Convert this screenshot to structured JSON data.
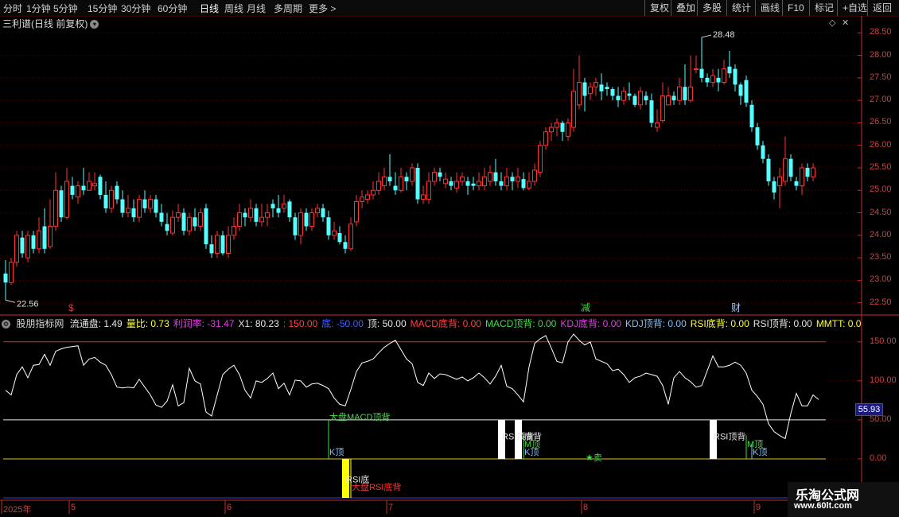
{
  "toolbar": {
    "timeframes": [
      "分时",
      "1分钟",
      "5分钟",
      "15分钟",
      "30分钟",
      "60分钟",
      "日线",
      "周线",
      "月线",
      "多周期",
      "更多 >"
    ],
    "active": "日线",
    "right_buttons": [
      "复权",
      "叠加",
      "多股",
      "统计",
      "画线",
      "F10",
      "标记",
      "+自选",
      "返回"
    ]
  },
  "main": {
    "title": "三利谱(日线 前复权)",
    "high_label": "28.48",
    "low_label": "22.56",
    "markers": [
      {
        "text": "$",
        "color": "#ff3030",
        "index": 12
      },
      {
        "text": "减",
        "color": "#30e030",
        "index": 104
      },
      {
        "text": "财",
        "color": "#9ec8ff",
        "index": 131
      }
    ]
  },
  "indicator": {
    "title": "股朋指标网",
    "fields": [
      {
        "text": "流通盘: 1.49",
        "color": "#e6e6e6"
      },
      {
        "text": "量比: 0.73",
        "color": "#ffff40"
      },
      {
        "text": "利润率: -31.47",
        "color": "#e040e0"
      },
      {
        "text": "X1: 80.23",
        "color": "#e6e6e6"
      },
      {
        "text": ": 150.00",
        "color": "#ff4040"
      },
      {
        "text": "底: -50.00",
        "color": "#4060ff"
      },
      {
        "text": "顶: 50.00",
        "color": "#e6e6e6"
      },
      {
        "text": "MACD底背: 0.00",
        "color": "#ff4040"
      },
      {
        "text": "MACD顶背: 0.00",
        "color": "#40e040"
      },
      {
        "text": "KDJ底背: 0.00",
        "color": "#e040e0"
      },
      {
        "text": "KDJ顶背: 0.00",
        "color": "#80c0ff"
      },
      {
        "text": "RSI底背: 0.00",
        "color": "#ffff40"
      },
      {
        "text": "RSI顶背: 0.00",
        "color": "#e6e6e6"
      },
      {
        "text": "MMTT: 0.0",
        "color": "#ffff40"
      }
    ],
    "current_value": "55.93",
    "annotations": [
      {
        "text": "大盘MACD顶背",
        "color": "#40e040",
        "index": 58,
        "y": 50
      },
      {
        "text": "K顶",
        "color": "#80c0ff",
        "index": 58,
        "y": 5
      },
      {
        "text": "RSI底",
        "color": "#e6e6e6",
        "index": 61,
        "y": -30
      },
      {
        "text": "大盘RSI底背",
        "color": "#ff3030",
        "index": 62,
        "y": -40
      },
      {
        "text": "RSI顶背",
        "color": "#e6e6e6",
        "index": 89,
        "y": 25
      },
      {
        "text": "底背",
        "color": "#e6e6e6",
        "index": 93,
        "y": 25
      },
      {
        "text": "M顶",
        "color": "#40e040",
        "index": 93,
        "y": 15
      },
      {
        "text": "K顶",
        "color": "#80c0ff",
        "index": 93,
        "y": 5
      },
      {
        "text": "★卖",
        "color": "#40e040",
        "index": 104,
        "y": -2
      },
      {
        "text": "RSI顶背",
        "color": "#e6e6e6",
        "index": 127,
        "y": 25
      },
      {
        "text": "M顶",
        "color": "#40e040",
        "index": 133,
        "y": 15
      },
      {
        "text": "K顶",
        "color": "#80c0ff",
        "index": 134,
        "y": 5
      }
    ]
  },
  "axes": {
    "price_ticks": [
      "28.50",
      "28.00",
      "27.50",
      "27.00",
      "26.50",
      "26.00",
      "25.50",
      "25.00",
      "24.50",
      "24.00",
      "23.50",
      "23.00",
      "22.50"
    ],
    "indicator_ticks": [
      "150.00",
      "100.00",
      "50.00",
      "0.00"
    ],
    "date_labels": [
      {
        "text": "2025年",
        "index": 0
      },
      {
        "text": "5",
        "index": 12
      },
      {
        "text": "6",
        "index": 40
      },
      {
        "text": "7",
        "index": 69
      },
      {
        "text": "8",
        "index": 104
      },
      {
        "text": "9",
        "index": 135
      }
    ]
  },
  "watermark": {
    "name": "乐淘公式网",
    "url": "www.60lt.com"
  },
  "chart_data": {
    "type": "candlestick",
    "candles": [
      [
        23.15,
        22.95,
        23.45,
        22.56
      ],
      [
        22.95,
        23.4,
        23.5,
        22.9
      ],
      [
        23.4,
        24.0,
        24.1,
        23.3
      ],
      [
        23.95,
        23.6,
        24.1,
        23.5
      ],
      [
        23.5,
        24.0,
        24.1,
        23.4
      ],
      [
        24.0,
        23.7,
        24.1,
        23.6
      ],
      [
        23.7,
        24.1,
        24.4,
        23.6
      ],
      [
        24.2,
        23.7,
        24.6,
        23.6
      ],
      [
        23.75,
        24.2,
        24.8,
        23.7
      ],
      [
        24.2,
        25.0,
        25.4,
        24.1
      ],
      [
        25.0,
        24.4,
        25.1,
        24.3
      ],
      [
        24.4,
        25.2,
        25.5,
        24.35
      ],
      [
        25.1,
        24.9,
        25.3,
        24.8
      ],
      [
        24.85,
        25.1,
        25.2,
        24.7
      ],
      [
        25.1,
        25.0,
        25.5,
        24.9
      ],
      [
        25.0,
        25.2,
        25.4,
        25.0
      ],
      [
        25.1,
        25.15,
        25.4,
        25.0
      ],
      [
        25.3,
        24.9,
        25.35,
        24.8
      ],
      [
        24.9,
        24.6,
        25.2,
        24.5
      ],
      [
        24.6,
        25.0,
        25.1,
        24.5
      ],
      [
        25.1,
        24.8,
        25.2,
        24.7
      ],
      [
        24.8,
        24.5,
        25.0,
        24.4
      ],
      [
        24.5,
        24.6,
        24.9,
        24.4
      ],
      [
        24.6,
        24.4,
        24.8,
        24.3
      ],
      [
        24.4,
        24.8,
        24.9,
        24.3
      ],
      [
        24.8,
        24.6,
        25.0,
        24.5
      ],
      [
        24.6,
        24.8,
        24.9,
        24.5
      ],
      [
        24.8,
        24.5,
        24.9,
        24.4
      ],
      [
        24.5,
        24.3,
        24.7,
        24.2
      ],
      [
        24.25,
        24.1,
        24.5,
        24.0
      ],
      [
        24.05,
        24.4,
        24.55,
        24.0
      ],
      [
        24.4,
        24.5,
        24.7,
        24.3
      ],
      [
        24.5,
        24.1,
        24.6,
        24.0
      ],
      [
        24.1,
        24.4,
        24.5,
        24.0
      ],
      [
        24.4,
        24.2,
        24.6,
        24.1
      ],
      [
        24.2,
        24.5,
        24.6,
        24.1
      ],
      [
        24.6,
        23.8,
        24.7,
        23.7
      ],
      [
        23.8,
        23.6,
        24.0,
        23.5
      ],
      [
        23.6,
        24.0,
        24.1,
        23.5
      ],
      [
        24.0,
        23.6,
        24.1,
        23.55
      ],
      [
        23.6,
        24.0,
        24.2,
        23.5
      ],
      [
        24.0,
        24.2,
        24.4,
        23.9
      ],
      [
        24.2,
        24.5,
        24.7,
        24.1
      ],
      [
        24.5,
        24.4,
        24.6,
        24.2
      ],
      [
        24.4,
        24.6,
        24.8,
        24.3
      ],
      [
        24.6,
        24.3,
        24.7,
        24.2
      ],
      [
        24.3,
        24.4,
        24.7,
        24.2
      ],
      [
        24.4,
        24.5,
        24.7,
        24.2
      ],
      [
        24.7,
        24.6,
        24.8,
        24.4
      ],
      [
        24.6,
        24.5,
        24.9,
        24.4
      ],
      [
        24.6,
        24.7,
        24.9,
        24.5
      ],
      [
        24.75,
        24.4,
        24.8,
        24.3
      ],
      [
        24.4,
        24.0,
        24.5,
        23.9
      ],
      [
        24.0,
        24.5,
        24.6,
        23.8
      ],
      [
        24.5,
        24.2,
        24.6,
        24.1
      ],
      [
        24.2,
        24.5,
        24.6,
        24.1
      ],
      [
        24.5,
        24.6,
        24.7,
        24.4
      ],
      [
        24.6,
        24.4,
        24.7,
        24.3
      ],
      [
        24.4,
        24.0,
        24.55,
        23.9
      ],
      [
        24.0,
        24.1,
        24.3,
        23.9
      ],
      [
        24.05,
        23.85,
        24.2,
        23.8
      ],
      [
        23.85,
        23.7,
        24.0,
        23.6
      ],
      [
        23.7,
        24.25,
        24.4,
        23.65
      ],
      [
        24.3,
        24.75,
        24.9,
        24.2
      ],
      [
        24.75,
        24.85,
        25.0,
        24.6
      ],
      [
        24.8,
        24.9,
        25.0,
        24.7
      ],
      [
        24.9,
        25.0,
        25.2,
        24.8
      ],
      [
        25.0,
        25.2,
        25.4,
        24.9
      ],
      [
        25.1,
        25.3,
        25.5,
        25.0
      ],
      [
        25.3,
        25.2,
        25.8,
        25.1
      ],
      [
        25.1,
        25.0,
        25.4,
        24.9
      ],
      [
        25.0,
        25.3,
        25.5,
        24.95
      ],
      [
        25.3,
        25.2,
        25.4,
        25.0
      ],
      [
        25.2,
        25.5,
        25.6,
        25.1
      ],
      [
        25.5,
        24.8,
        25.6,
        24.7
      ],
      [
        24.8,
        24.9,
        25.1,
        24.7
      ],
      [
        24.8,
        25.2,
        25.4,
        24.7
      ],
      [
        25.2,
        25.4,
        25.5,
        25.1
      ],
      [
        25.4,
        25.3,
        25.5,
        25.2
      ],
      [
        25.15,
        25.25,
        25.4,
        25.05
      ],
      [
        25.2,
        25.1,
        25.3,
        25.0
      ],
      [
        25.05,
        25.2,
        25.4,
        24.95
      ],
      [
        25.2,
        25.3,
        25.4,
        25.1
      ],
      [
        25.2,
        25.1,
        25.3,
        24.9
      ],
      [
        25.15,
        25.1,
        25.3,
        25.0
      ],
      [
        25.1,
        25.2,
        25.4,
        25.0
      ],
      [
        25.1,
        25.3,
        25.5,
        25.0
      ],
      [
        25.2,
        25.4,
        25.55,
        25.1
      ],
      [
        25.4,
        25.2,
        25.7,
        25.1
      ],
      [
        25.2,
        25.1,
        25.4,
        25.0
      ],
      [
        25.1,
        25.3,
        25.5,
        25.0
      ],
      [
        25.3,
        25.2,
        25.4,
        25.0
      ],
      [
        25.2,
        25.3,
        25.5,
        25.05
      ],
      [
        25.25,
        25.05,
        25.4,
        25.0
      ],
      [
        25.05,
        25.2,
        25.4,
        25.0
      ],
      [
        25.2,
        25.45,
        25.6,
        25.1
      ],
      [
        25.4,
        26.0,
        26.1,
        25.3
      ],
      [
        26.0,
        26.3,
        26.4,
        25.9
      ],
      [
        26.3,
        26.4,
        26.5,
        26.1
      ],
      [
        26.4,
        26.5,
        26.6,
        26.2
      ],
      [
        26.5,
        26.3,
        26.55,
        26.1
      ],
      [
        26.2,
        26.5,
        26.6,
        26.1
      ],
      [
        26.4,
        27.2,
        27.7,
        26.3
      ],
      [
        26.9,
        27.4,
        28.0,
        26.8
      ],
      [
        27.4,
        27.1,
        27.5,
        26.75
      ],
      [
        27.15,
        27.3,
        27.4,
        27.0
      ],
      [
        27.3,
        27.4,
        27.5,
        27.1
      ],
      [
        27.35,
        27.2,
        27.6,
        27.0
      ],
      [
        27.3,
        27.25,
        27.4,
        27.1
      ],
      [
        27.25,
        27.1,
        27.3,
        27.0
      ],
      [
        27.1,
        27.0,
        27.3,
        26.85
      ],
      [
        27.0,
        27.2,
        27.3,
        26.9
      ],
      [
        27.15,
        27.1,
        27.4,
        27.0
      ],
      [
        27.1,
        26.9,
        27.15,
        26.85
      ],
      [
        26.9,
        27.2,
        27.3,
        26.8
      ],
      [
        27.1,
        27.0,
        27.2,
        26.9
      ],
      [
        27.0,
        26.5,
        27.15,
        26.4
      ],
      [
        26.4,
        26.5,
        26.8,
        26.3
      ],
      [
        26.55,
        27.1,
        27.4,
        26.5
      ],
      [
        26.9,
        27.1,
        27.3,
        26.9
      ],
      [
        27.1,
        27.0,
        27.2,
        26.9
      ],
      [
        27.0,
        27.3,
        27.5,
        26.9
      ],
      [
        27.3,
        27.0,
        27.8,
        26.9
      ],
      [
        27.0,
        27.3,
        28.0,
        26.95
      ],
      [
        27.7,
        27.7,
        28.0,
        27.6
      ],
      [
        27.7,
        27.5,
        28.4,
        27.4
      ],
      [
        27.5,
        27.4,
        27.6,
        27.3
      ],
      [
        27.4,
        27.55,
        27.7,
        27.3
      ],
      [
        27.5,
        27.4,
        27.7,
        27.2
      ],
      [
        27.4,
        27.7,
        27.9,
        27.35
      ],
      [
        27.75,
        27.6,
        28.1,
        27.5
      ],
      [
        27.7,
        27.35,
        27.8,
        27.2
      ],
      [
        27.35,
        27.1,
        27.4,
        26.9
      ],
      [
        27.45,
        26.95,
        27.55,
        26.85
      ],
      [
        26.9,
        26.4,
        27.0,
        26.3
      ],
      [
        26.4,
        26.0,
        26.5,
        25.9
      ],
      [
        26.0,
        25.7,
        26.1,
        25.6
      ],
      [
        25.7,
        25.2,
        25.8,
        25.1
      ],
      [
        25.2,
        24.95,
        25.3,
        24.8
      ],
      [
        25.1,
        25.3,
        25.5,
        24.6
      ],
      [
        25.2,
        25.7,
        26.2,
        25.1
      ],
      [
        25.7,
        25.3,
        25.8,
        25.2
      ],
      [
        25.2,
        25.1,
        25.3,
        25.0
      ],
      [
        25.1,
        25.5,
        25.6,
        24.9
      ],
      [
        25.5,
        25.3,
        25.6,
        25.2
      ],
      [
        25.3,
        25.5,
        25.6,
        25.2
      ]
    ],
    "ylim": [
      22.3,
      28.7
    ],
    "indicator": {
      "type": "line",
      "y_label_ticks": [
        0,
        50,
        100,
        150
      ],
      "ylim": [
        -50,
        160
      ],
      "line": [
        88,
        82,
        108,
        118,
        104,
        120,
        121,
        134,
        120,
        138,
        141,
        143,
        144,
        145,
        120,
        128,
        130,
        124,
        120,
        108,
        92,
        91,
        92,
        91,
        102,
        92,
        82,
        69,
        66,
        74,
        95,
        68,
        72,
        116,
        100,
        96,
        60,
        55,
        82,
        108,
        115,
        120,
        108,
        88,
        78,
        100,
        98,
        103,
        110,
        90,
        97,
        82,
        101,
        100,
        92,
        96,
        97,
        94,
        90,
        78,
        70,
        68,
        89,
        112,
        123,
        125,
        128,
        136,
        143,
        148,
        152,
        140,
        128,
        122,
        98,
        94,
        110,
        103,
        109,
        108,
        105,
        102,
        105,
        100,
        104,
        110,
        104,
        96,
        106,
        120,
        93,
        90,
        82,
        73,
        118,
        148,
        154,
        158,
        142,
        125,
        123,
        150,
        160,
        152,
        146,
        150,
        128,
        125,
        122,
        113,
        115,
        108,
        98,
        104,
        106,
        110,
        108,
        106,
        94,
        70,
        104,
        112,
        104,
        99,
        92,
        94,
        113,
        132,
        118,
        118,
        120,
        124,
        120,
        110,
        88,
        80,
        70,
        45,
        35,
        30,
        26,
        58,
        84,
        68,
        68,
        82,
        76
      ]
    },
    "bars": [
      {
        "index": 61,
        "from": 0,
        "to": -50,
        "color": "#ffff00"
      },
      {
        "index": 89,
        "from": 50,
        "to": 0,
        "color": "#ffffff"
      },
      {
        "index": 92,
        "from": 50,
        "to": 0,
        "color": "#ffffff"
      },
      {
        "index": 127,
        "from": 50,
        "to": 0,
        "color": "#ffffff"
      }
    ],
    "reference_lines": [
      {
        "value": 150,
        "color": "#d03030"
      },
      {
        "value": 50,
        "color": "#e6e6e6"
      },
      {
        "value": 0,
        "color": "#e0c030"
      },
      {
        "value": -50,
        "color": "#3040d0"
      }
    ]
  }
}
